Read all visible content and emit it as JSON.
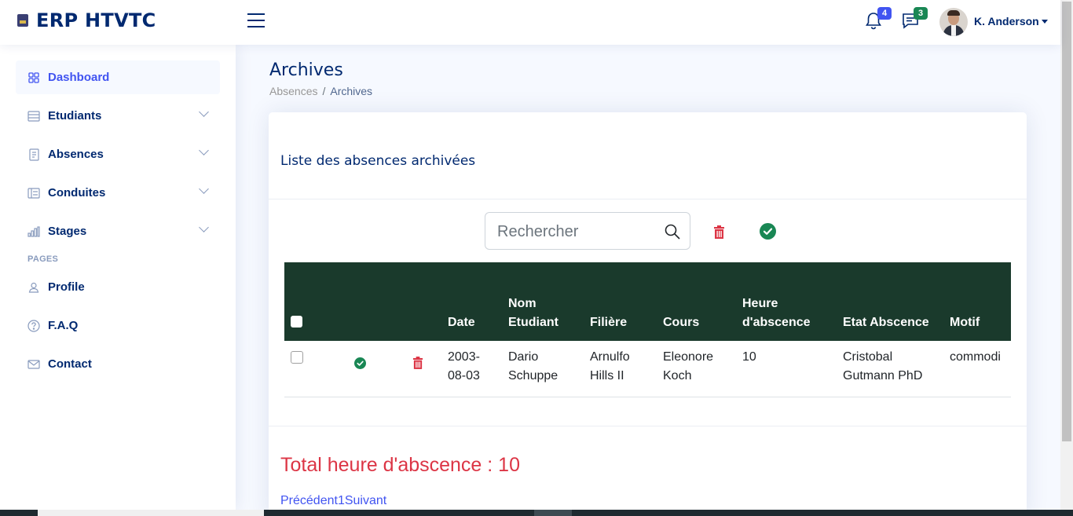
{
  "app": {
    "title": "ERP HTVTC"
  },
  "header": {
    "notifications_count": "4",
    "messages_count": "3",
    "user_name": "K. Anderson"
  },
  "sidebar": {
    "items": [
      {
        "label": "Dashboard",
        "icon": "grid-icon",
        "active": true
      },
      {
        "label": "Etudiants",
        "icon": "list-icon"
      },
      {
        "label": "Absences",
        "icon": "journal-icon"
      },
      {
        "label": "Conduites",
        "icon": "layout-text-icon"
      },
      {
        "label": "Stages",
        "icon": "bar-chart-icon"
      }
    ],
    "section_label": "PAGES",
    "pages": [
      {
        "label": "Profile",
        "icon": "person-icon"
      },
      {
        "label": "F.A.Q",
        "icon": "question-circle-icon"
      },
      {
        "label": "Contact",
        "icon": "envelope-icon"
      }
    ]
  },
  "page": {
    "title": "Archives",
    "breadcrumb": [
      {
        "label": "Absences"
      },
      {
        "label": "Archives"
      }
    ],
    "breadcrumb_sep": "/"
  },
  "card": {
    "title": "Liste des absences archivées",
    "search_placeholder": "Rechercher",
    "table": {
      "columns": [
        "",
        "",
        "",
        "Date",
        "Nom Etudiant",
        "Filière",
        "Cours",
        "Heure d'abscence",
        "Etat Abscence",
        "Motif"
      ],
      "rows": [
        {
          "date": "2003-08-03",
          "nom": "Dario Schuppe",
          "filiere": "Arnulfo Hills II",
          "cours": "Eleonore Koch",
          "heure": "10",
          "etat": "Cristobal Gutmann PhD",
          "motif": "commodi"
        }
      ]
    },
    "total_label": "Total heure d'abscence : 10",
    "pagination": {
      "prev": "Précédent",
      "page": "1",
      "next": "Suivant"
    }
  },
  "colors": {
    "brand": "#012970",
    "accent": "#4154f1",
    "table_header": "#1a3a2c",
    "danger": "#dc3545",
    "success": "#198754"
  }
}
